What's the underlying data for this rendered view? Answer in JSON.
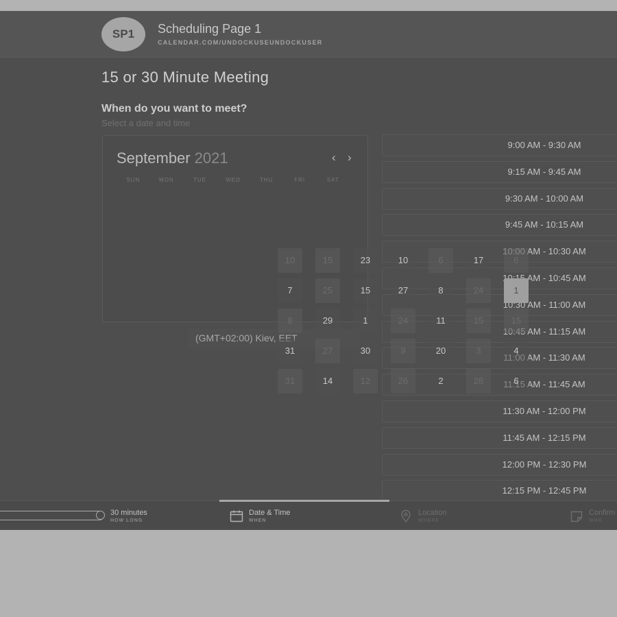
{
  "header": {
    "avatar_initials": "SP1",
    "title": "Scheduling Page 1",
    "url": "CALENDAR.COM/UNDOCKUSEUNDOCKUSER"
  },
  "meeting": {
    "title": "15 or 30 Minute Meeting",
    "question": "When do you want to meet?",
    "hint": "Select a date and time"
  },
  "calendar": {
    "month": "September",
    "year": "2021",
    "prev_icon": "chevron-left-icon",
    "next_icon": "chevron-right-icon",
    "weekdays": [
      "SUN",
      "MON",
      "TUE",
      "WED",
      "THU",
      "FRI",
      "SAT"
    ],
    "selected_day": "1"
  },
  "days": [
    {
      "label": "10",
      "style": "dim"
    },
    {
      "label": "15",
      "style": "dim"
    },
    {
      "label": "23",
      "style": "bright"
    },
    {
      "label": "10",
      "style": "bright"
    },
    {
      "label": "6",
      "style": "dim"
    },
    {
      "label": "17",
      "style": "bright"
    },
    {
      "label": "6",
      "style": "dim"
    },
    {
      "label": "7",
      "style": "bright"
    },
    {
      "label": "25",
      "style": "dim"
    },
    {
      "label": "15",
      "style": "bright"
    },
    {
      "label": "27",
      "style": "bright"
    },
    {
      "label": "8",
      "style": "bright"
    },
    {
      "label": "24",
      "style": "dim"
    },
    {
      "label": "1",
      "style": "sel"
    },
    {
      "label": "8",
      "style": "dim"
    },
    {
      "label": "29",
      "style": "bright"
    },
    {
      "label": "1",
      "style": "bright"
    },
    {
      "label": "24",
      "style": "dim"
    },
    {
      "label": "11",
      "style": "bright"
    },
    {
      "label": "15",
      "style": "dim"
    },
    {
      "label": "15",
      "style": "dim"
    },
    {
      "label": "31",
      "style": "bright"
    },
    {
      "label": "27",
      "style": "dim"
    },
    {
      "label": "30",
      "style": "bright"
    },
    {
      "label": "9",
      "style": "dim"
    },
    {
      "label": "20",
      "style": "bright"
    },
    {
      "label": "3",
      "style": "dim"
    },
    {
      "label": "4",
      "style": "bright"
    },
    {
      "label": "31",
      "style": "dim"
    },
    {
      "label": "14",
      "style": "bright"
    },
    {
      "label": "12",
      "style": "dim"
    },
    {
      "label": "26",
      "style": "dim"
    },
    {
      "label": "2",
      "style": "bright"
    },
    {
      "label": "28",
      "style": "dim"
    },
    {
      "label": "6",
      "style": "bright"
    }
  ],
  "timezone": "(GMT+02:00) Kiev, EET",
  "time_slots": [
    "9:00 AM - 9:30 AM",
    "9:15 AM - 9:45 AM",
    "9:30 AM - 10:00 AM",
    "9:45 AM - 10:15 AM",
    "10:00 AM - 10:30 AM",
    "10:15 AM - 10:45 AM",
    "10:30 AM - 11:00 AM",
    "10:45 AM - 11:15 AM",
    "11:00 AM - 11:30 AM",
    "11:15 AM - 11:45 AM",
    "11:30 AM - 12:00 PM",
    "11:45 AM - 12:15 PM",
    "12:00 PM - 12:30 PM",
    "12:15 PM - 12:45 PM"
  ],
  "steps": [
    {
      "label": "30 minutes",
      "sub": "HOW LONG",
      "icon": "clock-icon"
    },
    {
      "label": "Date & Time",
      "sub": "WHEN",
      "icon": "calendar-icon"
    },
    {
      "label": "Location",
      "sub": "WHERE",
      "icon": "location-pin-icon"
    },
    {
      "label": "Confirm",
      "sub": "WHO",
      "icon": "note-icon"
    }
  ]
}
